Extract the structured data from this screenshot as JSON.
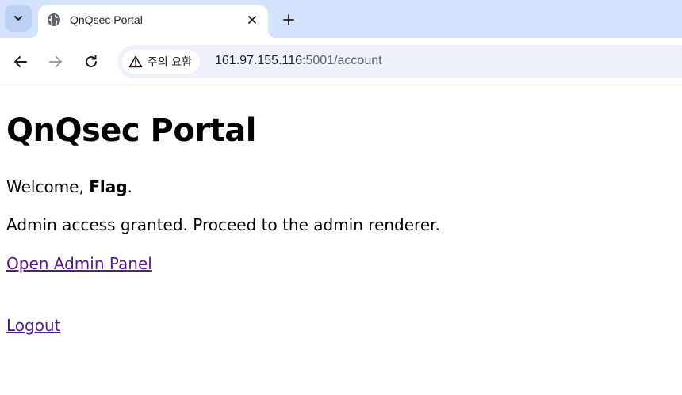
{
  "browser": {
    "tab": {
      "title": "QnQsec Portal",
      "favicon": "globe-icon"
    },
    "new_tab_icon": "plus-icon",
    "security_chip": {
      "label": "주의 요함",
      "icon": "warning-triangle-icon"
    },
    "url": {
      "host": "161.97.155.116",
      "rest": ":5001/account"
    }
  },
  "page": {
    "title": "QnQsec Portal",
    "welcome_prefix": "Welcome, ",
    "welcome_user": "Flag",
    "welcome_suffix": ".",
    "admin_message": "Admin access granted. Proceed to the admin renderer.",
    "admin_link": "Open Admin Panel",
    "logout_link": "Logout"
  },
  "colors": {
    "tabstrip_bg": "#d3e3fd",
    "omnibox_bg": "#edf2fa",
    "visited_link": "#551a8b"
  }
}
